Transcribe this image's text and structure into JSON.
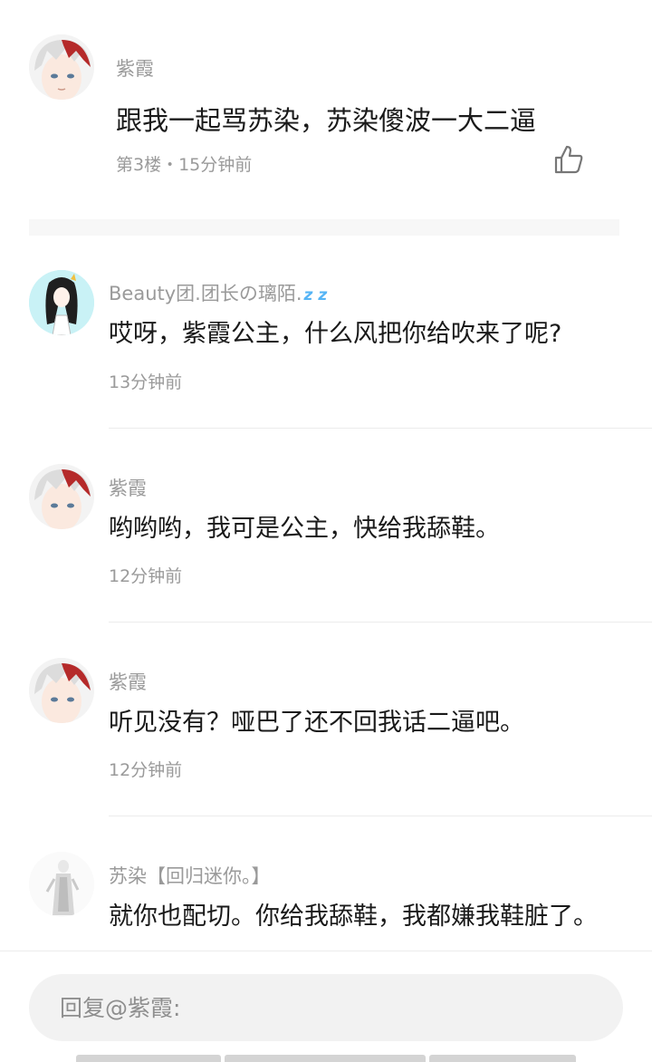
{
  "post": {
    "author": "紫霞",
    "text": "跟我一起骂苏染，苏染傻波一大二逼",
    "meta": "第3楼・15分钟前"
  },
  "comments": [
    {
      "author": "Beauty团.团长の璃陌.",
      "author_badge": "z z",
      "text": "哎呀，紫霞公主，什么风把你给吹来了呢?",
      "time": "13分钟前"
    },
    {
      "author": "紫霞",
      "text": "哟哟哟，我可是公主，快给我舔鞋。",
      "time": "12分钟前"
    },
    {
      "author": "紫霞",
      "text": "听见没有？哑巴了还不回我话二逼吧。",
      "time": "12分钟前"
    },
    {
      "author": "苏染【回归迷你。】",
      "text": "就你也配切。你给我舔鞋，我都嫌我鞋脏了。"
    }
  ],
  "reply": {
    "placeholder": "回复@紫霞:"
  },
  "icons": {
    "like": "thumbs-up-icon",
    "badge": "sleep-zzz-icon"
  },
  "colors": {
    "background": "#ffffff",
    "secondary_text": "#9a9a9a",
    "primary_text": "#1a1a1a",
    "input_bg": "#f2f2f2"
  }
}
